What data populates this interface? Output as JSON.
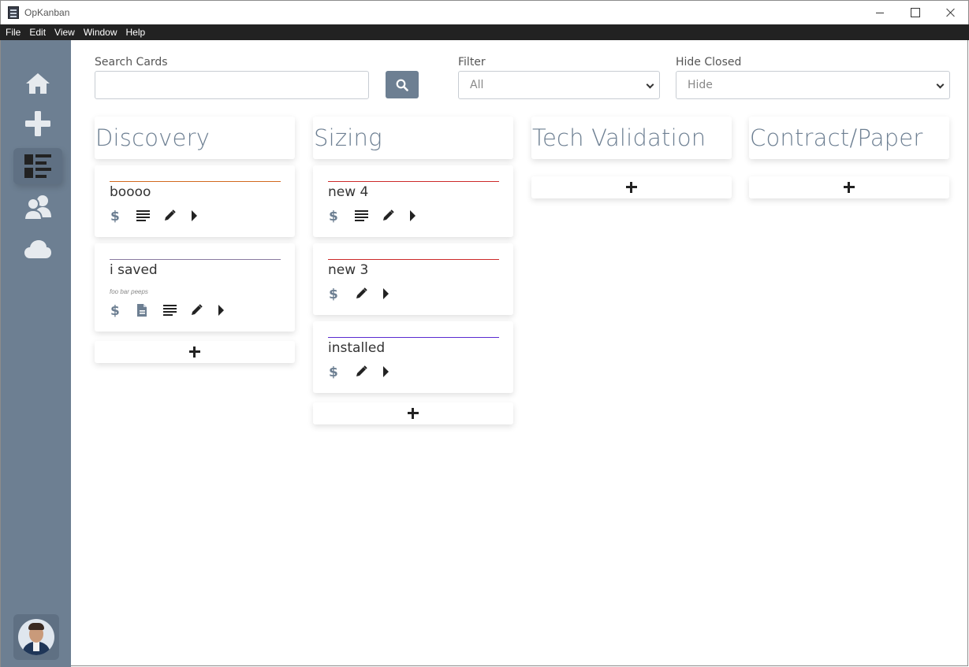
{
  "window": {
    "title": "OpKanban"
  },
  "menubar": {
    "items": [
      "File",
      "Edit",
      "View",
      "Window",
      "Help"
    ]
  },
  "sidebar": {
    "items": [
      {
        "name": "home",
        "icon": "home-icon",
        "active": false
      },
      {
        "name": "add",
        "icon": "plus-icon",
        "active": false
      },
      {
        "name": "board",
        "icon": "board-list-icon",
        "active": true
      },
      {
        "name": "users",
        "icon": "users-icon",
        "active": false
      },
      {
        "name": "cloud",
        "icon": "cloud-icon",
        "active": false
      }
    ],
    "profile_icon": "user-avatar"
  },
  "toolbar": {
    "search_label": "Search Cards",
    "search_value": "",
    "search_icon": "magnifier-icon",
    "filter_label": "Filter",
    "filter_value": "All",
    "hide_closed_label": "Hide Closed",
    "hide_closed_value": "Hide"
  },
  "colors": {
    "sidebar": "#6d7f92",
    "accent": "#6d7f92",
    "menubar": "#222222"
  },
  "columns": [
    {
      "title": "Discovery",
      "cards": [
        {
          "title": "boooo",
          "note": "",
          "rule_color": "#d2691e",
          "icons": [
            "dollar-icon",
            "notes-icon",
            "edit-icon",
            "arrow-right-icon"
          ]
        },
        {
          "title": "i saved",
          "note": "foo bar peeps",
          "rule_color": "#8a7aa0",
          "icons": [
            "dollar-icon",
            "document-icon",
            "notes-icon",
            "edit-icon",
            "arrow-right-icon"
          ]
        }
      ]
    },
    {
      "title": "Sizing",
      "cards": [
        {
          "title": "new 4",
          "note": "",
          "rule_color": "#cc2a2a",
          "icons": [
            "dollar-icon",
            "notes-icon",
            "edit-icon",
            "arrow-right-icon"
          ]
        },
        {
          "title": "new 3",
          "note": "",
          "rule_color": "#cc2a2a",
          "icons": [
            "dollar-icon",
            "edit-icon",
            "arrow-right-icon"
          ]
        },
        {
          "title": "installed",
          "note": "",
          "rule_color": "#5a2ad0",
          "icons": [
            "dollar-icon",
            "edit-icon",
            "arrow-right-icon"
          ]
        }
      ]
    },
    {
      "title": "Tech Validation",
      "cards": []
    },
    {
      "title": "Contract/Paper",
      "cards": []
    }
  ]
}
